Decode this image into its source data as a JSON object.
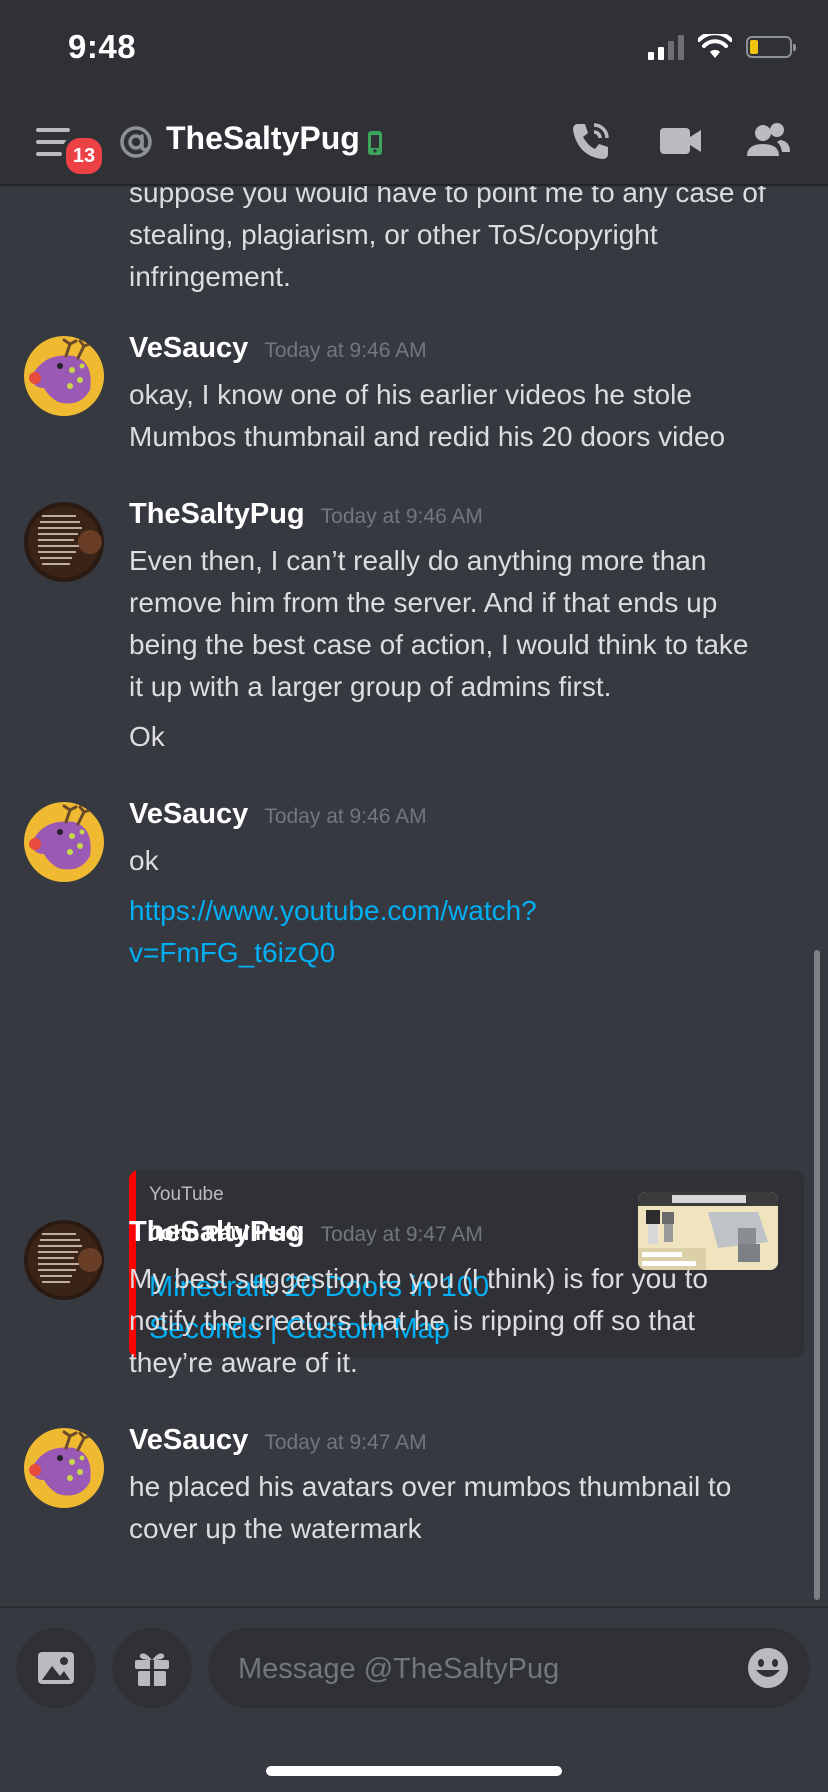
{
  "status_bar": {
    "time": "9:48"
  },
  "header": {
    "unread_badge": "13",
    "channel_name": "TheSaltyPug",
    "icons": [
      "menu-icon",
      "at-icon",
      "mobile-status-icon",
      "call-icon",
      "video-icon",
      "members-icon"
    ]
  },
  "messages": {
    "partial_top": {
      "lines": [
        "suppose you would have to point me to any case of",
        "stealing, plagiarism, or other ToS/copyright",
        "infringement."
      ]
    },
    "m1": {
      "author": "VeSaucy",
      "time": "Today at 9:46 AM",
      "lines": [
        "okay, I know one of his earlier videos he stole",
        "Mumbos thumbnail and redid his 20 doors video"
      ]
    },
    "m2": {
      "author": "TheSaltyPug",
      "time": "Today at 9:46 AM",
      "lines": [
        "Even then, I can’t really do anything more than",
        "remove him from the server. And if that ends up",
        "being the best case of action, I would think to take",
        "it up with a larger group of admins first."
      ],
      "followup": "Ok"
    },
    "m3": {
      "author": "VeSaucy",
      "time": "Today at 9:46 AM",
      "text": "ok",
      "link_line1": "https://www.youtube.com/watch?",
      "link_line2": "v=FmFG_t6izQ0",
      "embed": {
        "provider": "YouTube",
        "author": "John Paul Inso",
        "title_line1": "Minecraft: 20 Doors in 100",
        "title_line2": "Seconds | Custom Map",
        "accent": "#ff0000"
      }
    },
    "m4": {
      "author": "TheSaltyPug",
      "time": "Today at 9:47 AM",
      "lines": [
        "My best suggestion to you (I think) is for you to",
        "notify the creators that he is ripping off so that",
        "they’re aware of it."
      ]
    },
    "m5": {
      "author": "VeSaucy",
      "time": "Today at 9:47 AM",
      "lines": [
        "he placed his avatars over mumbos thumbnail to",
        "cover up the watermark"
      ]
    }
  },
  "composer": {
    "placeholder": "Message @TheSaltyPug",
    "icons": [
      "image-icon",
      "gift-icon",
      "emoji-icon"
    ]
  },
  "colors": {
    "background": "#36393f",
    "header": "#2f3136",
    "link": "#00aff4",
    "badge": "#ed4245",
    "online_mobile": "#3ba55c"
  }
}
